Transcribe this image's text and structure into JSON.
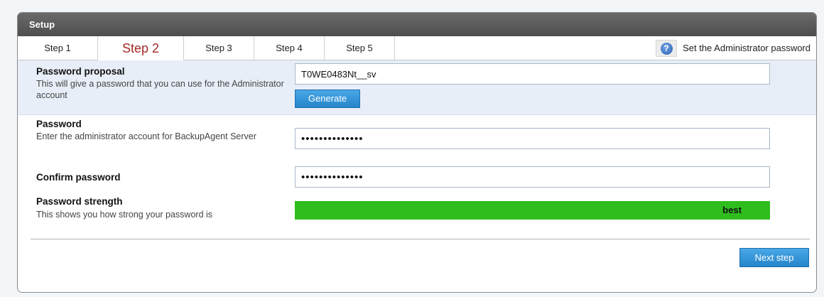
{
  "window": {
    "title": "Setup"
  },
  "tabs": [
    {
      "label": "Step 1"
    },
    {
      "label": "Step 2"
    },
    {
      "label": "Step 3"
    },
    {
      "label": "Step 4"
    },
    {
      "label": "Step 5"
    }
  ],
  "active_tab": "Step 2",
  "help": {
    "text": "Set the Administrator password",
    "icon": "help-icon"
  },
  "proposal": {
    "title": "Password proposal",
    "description": "This will give a password that you can use for the Administrator account",
    "value": "T0WE0483Nt__sv",
    "generate_label": "Generate"
  },
  "password": {
    "title": "Password",
    "description": "Enter the administrator account for BackupAgent Server",
    "masked_value": "••••••••••••••"
  },
  "confirm": {
    "title": "Confirm password",
    "masked_value": "••••••••••••••"
  },
  "strength": {
    "title": "Password strength",
    "description": "This shows you how strong your password is",
    "label": "best",
    "level": 1.0,
    "color": "#2ebd1c"
  },
  "footer": {
    "next_label": "Next step"
  },
  "colors": {
    "titlebar": "#555555",
    "active_tab": "#a52a2a",
    "button": "#2f8fd6",
    "highlight_row": "#e8eef8"
  }
}
